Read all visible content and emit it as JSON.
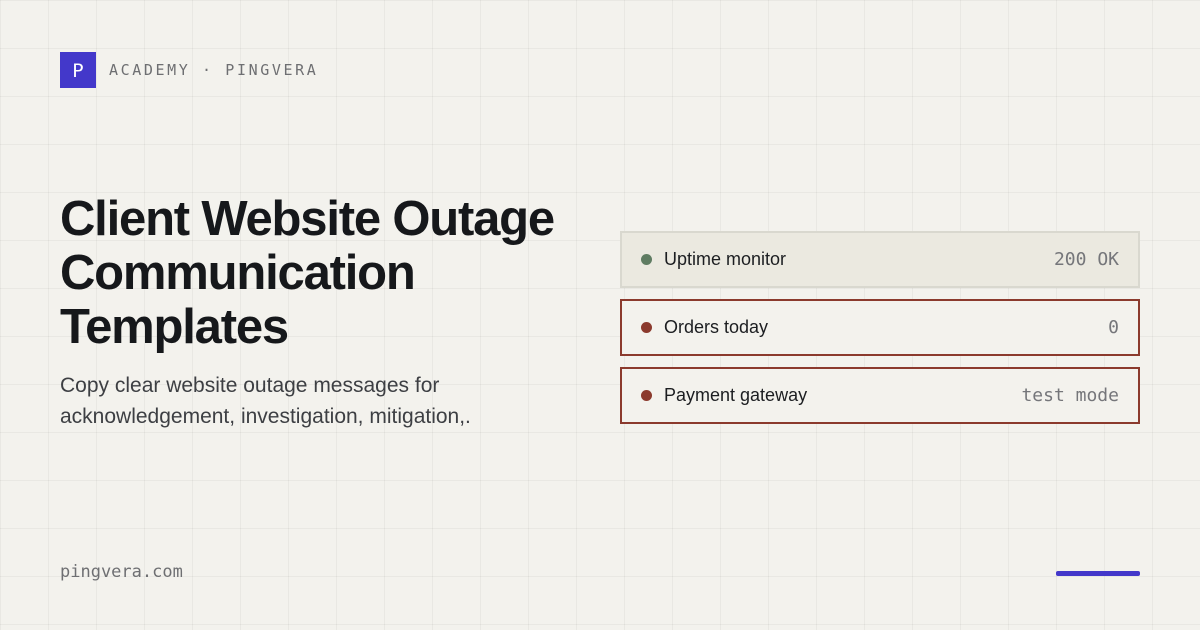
{
  "brand": {
    "logo_letter": "P",
    "label": "ACADEMY · PINGVERA",
    "accent_color": "#4338ca"
  },
  "hero": {
    "title": "Client Website Outage Communication Templates",
    "subtitle": "Copy clear website outage messages for acknowledgement, investigation, mitigation,."
  },
  "status_cards": [
    {
      "label": "Uptime monitor",
      "value": "200 OK",
      "status": "ok",
      "dot_color": "#5f7c62"
    },
    {
      "label": "Orders today",
      "value": "0",
      "status": "alert",
      "dot_color": "#8b3a2d"
    },
    {
      "label": "Payment gateway",
      "value": "test mode",
      "status": "alert",
      "dot_color": "#8b3a2d"
    }
  ],
  "footer": {
    "url": "pingvera.com"
  }
}
